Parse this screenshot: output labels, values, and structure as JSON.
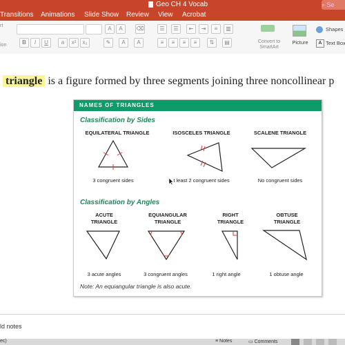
{
  "window": {
    "title": "Geo CH 4 Vocab",
    "search_hint": "⌕ Se"
  },
  "tabs": [
    "Transitions",
    "Animations",
    "Slide Show",
    "Review",
    "View",
    "Acrobat"
  ],
  "ribbon": {
    "left_labels": [
      "rt",
      "ion"
    ],
    "picture_label": "Picture",
    "shapes_label": "Shapes",
    "textbox_label": "Text Box",
    "convert_label": "Convert to",
    "smartart_label": "SmartArt"
  },
  "slide": {
    "highlight": "triangle",
    "sentence": "is a figure formed by three segments joining three noncollinear p",
    "panel_title": "NAMES OF TRIANGLES",
    "sides_heading": "Classification by Sides",
    "angles_heading": "Classification by Angles",
    "sides": [
      {
        "name": "EQUILATERAL TRIANGLE",
        "desc": "3 congruent sides"
      },
      {
        "name": "ISOSCELES TRIANGLE",
        "desc": "t least 2 congruent sides"
      },
      {
        "name": "SCALENE TRIANGLE",
        "desc": "No congruent sides"
      }
    ],
    "angles": [
      {
        "name1": "ACUTE",
        "name2": "TRIANGLE",
        "desc": "3 acute angles"
      },
      {
        "name1": "EQUIANGULAR",
        "name2": "TRIANGLE",
        "desc": "3 congruent angles"
      },
      {
        "name1": "RIGHT",
        "name2": "TRIANGLE",
        "desc": "1 right angle"
      },
      {
        "name1": "OBTUSE",
        "name2": "TRIANGLE",
        "desc": "1 obtuse angle"
      }
    ],
    "note": "Note: An equiangular triangle is also acute."
  },
  "notes_placeholder": "ld notes",
  "status": {
    "left": "ec)",
    "notes": "Notes",
    "comments": "Comments"
  },
  "colors": {
    "accent": "#c8452b",
    "panel_green": "#0f9a6a",
    "heading_green": "#1a8a58",
    "highlight": "#fbf59a",
    "mark_red": "#e53935"
  }
}
